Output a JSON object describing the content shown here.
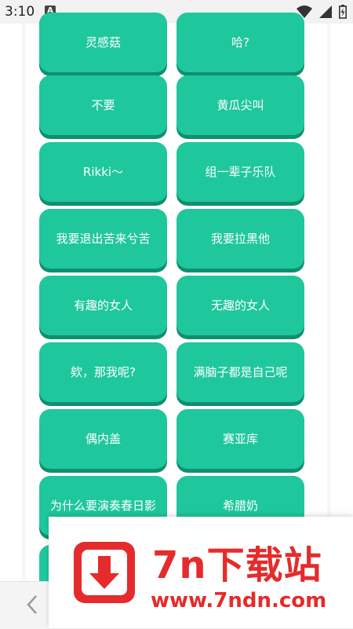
{
  "status_bar": {
    "time": "3:10",
    "notification_icon": "A"
  },
  "tiles": [
    {
      "label": "灵感菇"
    },
    {
      "label": "哈?"
    },
    {
      "label": "不要"
    },
    {
      "label": "黄瓜尖叫"
    },
    {
      "label": "Rikki～"
    },
    {
      "label": "组一辈子乐队"
    },
    {
      "label": "我要退出苦来兮苦"
    },
    {
      "label": "我要拉黑他"
    },
    {
      "label": "有趣的女人"
    },
    {
      "label": "无趣的女人"
    },
    {
      "label": "欸，那我呢?"
    },
    {
      "label": "满脑子都是自己呢"
    },
    {
      "label": "偶内盖"
    },
    {
      "label": "赛亚库"
    },
    {
      "label": "为什么要演奏春日影"
    },
    {
      "label": "希腊奶"
    },
    {
      "label": ""
    },
    {
      "label": ""
    }
  ],
  "ad": {
    "title": "7n下载站",
    "url": "www.7ndn.com"
  },
  "nav": {
    "back_icon": "chevron-left"
  },
  "colors": {
    "tile": "#1fc79c",
    "tile_shadow": "#0f8f70",
    "ad_red": "#e52b2b"
  }
}
